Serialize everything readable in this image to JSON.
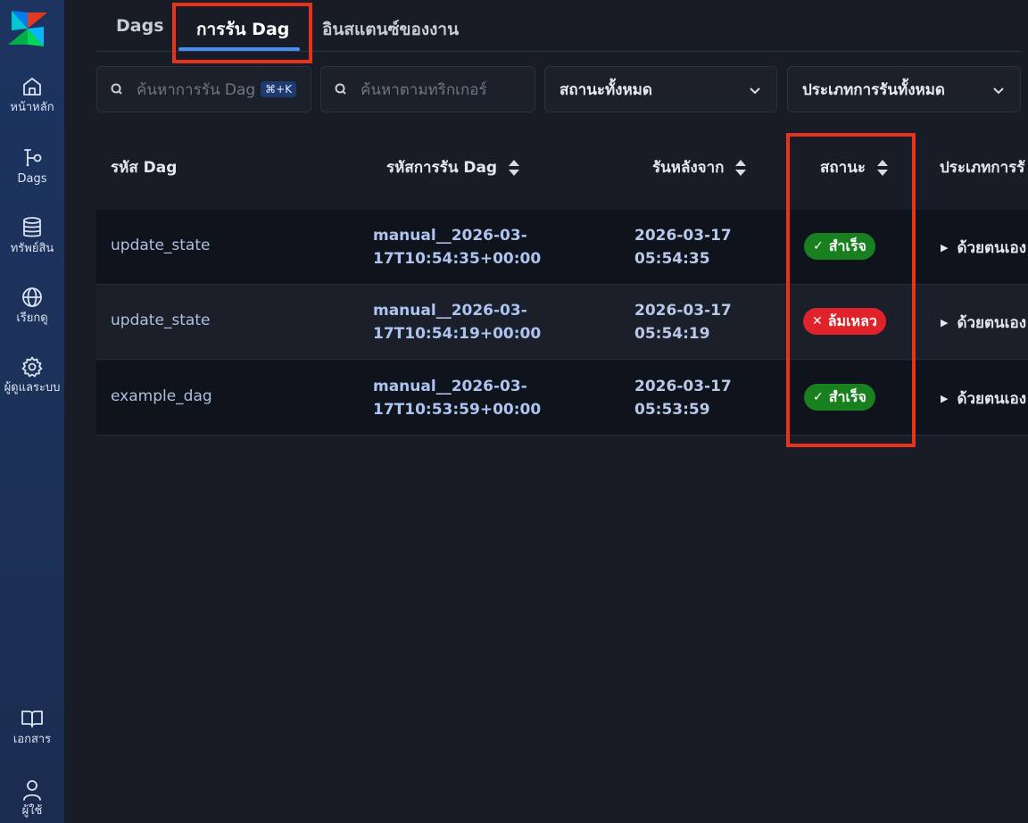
{
  "sidebar": {
    "items": [
      {
        "label": "หน้าหลัก",
        "icon": "home-icon"
      },
      {
        "label": "Dags",
        "icon": "dag-icon"
      },
      {
        "label": "ทรัพย์สิน",
        "icon": "database-icon"
      },
      {
        "label": "เรียกดู",
        "icon": "globe-icon"
      },
      {
        "label": "ผู้ดูแลระบบ",
        "icon": "gear-icon"
      },
      {
        "label": "เอกสาร",
        "icon": "book-icon"
      },
      {
        "label": "ผู้ใช้",
        "icon": "user-icon"
      }
    ]
  },
  "tabs": [
    {
      "label": "Dags"
    },
    {
      "label": "การรัน Dag",
      "active": true
    },
    {
      "label": "อินสแตนซ์ของงาน"
    }
  ],
  "filters": {
    "search_runs_placeholder": "ค้นหาการรัน Dag",
    "shortcut": "⌘+K",
    "search_trigger_placeholder": "ค้นหาตามทริกเกอร์",
    "status_select": "สถานะทั้งหมด",
    "run_type_select": "ประเภทการรันทั้งหมด"
  },
  "table": {
    "headers": {
      "dag_id": "รหัส Dag",
      "run_id": "รหัสการรัน Dag",
      "run_after": "รันหลังจาก",
      "state": "สถานะ",
      "run_type": "ประเภทการรั"
    },
    "rows": [
      {
        "dag_id": "update_state",
        "run_id_1": "manual__2026-03-",
        "run_id_2": "17T10:54:35+00:00",
        "run_after_1": "2026-03-17",
        "run_after_2": "05:54:35",
        "state": "สำเร็จ",
        "state_glyph": "✓",
        "run_type": "ด้วยตนเอง"
      },
      {
        "dag_id": "update_state",
        "run_id_1": "manual__2026-03-",
        "run_id_2": "17T10:54:19+00:00",
        "run_after_1": "2026-03-17",
        "run_after_2": "05:54:19",
        "state": "ล้มเหลว",
        "state_glyph": "✕",
        "run_type": "ด้วยตนเอง"
      },
      {
        "dag_id": "example_dag",
        "run_id_1": "manual__2026-03-",
        "run_id_2": "17T10:53:59+00:00",
        "run_after_1": "2026-03-17",
        "run_after_2": "05:53:59",
        "state": "สำเร็จ",
        "state_glyph": "✓",
        "run_type": "ด้วยตนเอง"
      }
    ]
  },
  "colors": {
    "success": "#18801e",
    "failed": "#e0222a",
    "highlight": "#e8321c",
    "accent": "#4a8ef0"
  }
}
